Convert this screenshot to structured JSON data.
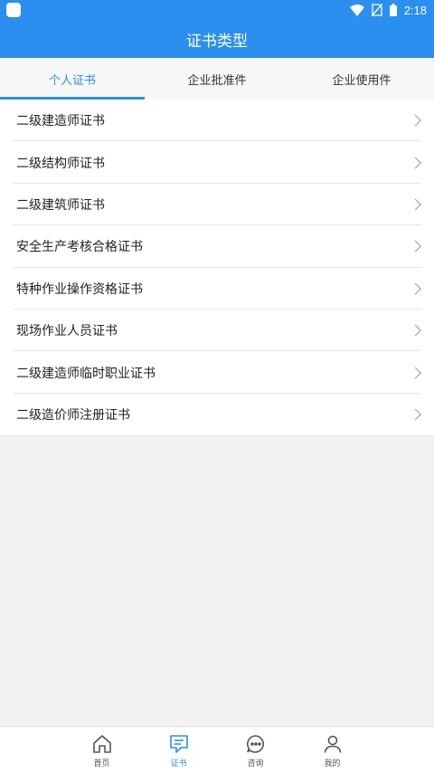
{
  "status_bar": {
    "time": "2:18",
    "icons": [
      "app-icon",
      "wifi-icon",
      "no-sim-icon",
      "battery-icon"
    ]
  },
  "header": {
    "title": "证书类型"
  },
  "tabs": [
    {
      "label": "个人证书",
      "active": true
    },
    {
      "label": "企业批准件",
      "active": false
    },
    {
      "label": "企业使用件",
      "active": false
    }
  ],
  "certificates": [
    {
      "label": "二级建造师证书"
    },
    {
      "label": "二级结构师证书"
    },
    {
      "label": "二级建筑师证书"
    },
    {
      "label": "安全生产考核合格证书"
    },
    {
      "label": "特种作业操作资格证书"
    },
    {
      "label": "现场作业人员证书"
    },
    {
      "label": "二级建造师临时职业证书"
    },
    {
      "label": "二级造价师注册证书"
    }
  ],
  "bottom_nav": [
    {
      "label": "首页",
      "icon": "home-icon",
      "active": false
    },
    {
      "label": "证书",
      "icon": "certificate-icon",
      "active": true
    },
    {
      "label": "咨询",
      "icon": "chat-icon",
      "active": false
    },
    {
      "label": "我的",
      "icon": "person-icon",
      "active": false
    }
  ],
  "colors": {
    "accent": "#2b8ff0",
    "background": "#f2f2f2"
  }
}
